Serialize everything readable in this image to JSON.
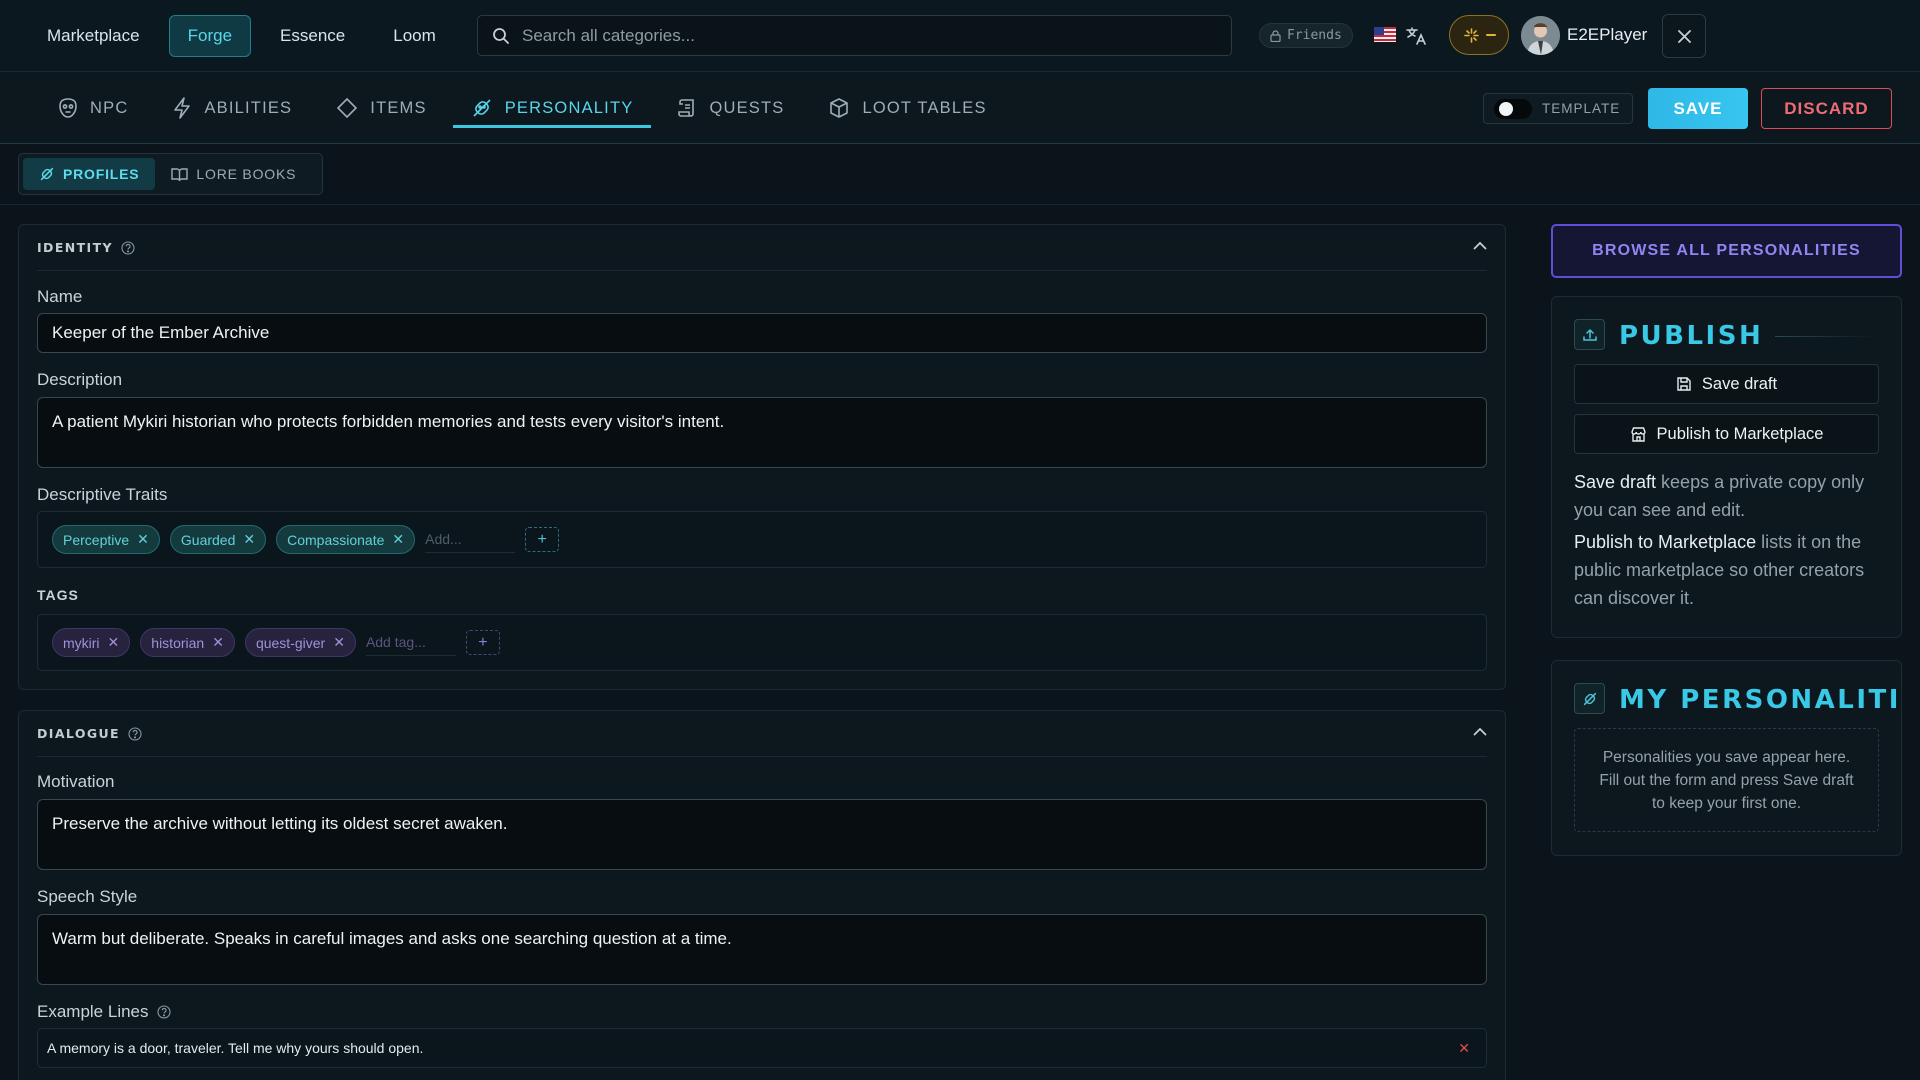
{
  "topnav": {
    "tabs": [
      "Marketplace",
      "Forge",
      "Essence",
      "Loom"
    ],
    "search_placeholder": "Search all categories...",
    "friends_label": "Friends",
    "username": "E2EPlayer"
  },
  "sections": {
    "tabs": [
      "NPC",
      "ABILITIES",
      "ITEMS",
      "PERSONALITY",
      "QUESTS",
      "LOOT TABLES"
    ],
    "template_label": "TEMPLATE",
    "save_label": "SAVE",
    "discard_label": "DISCARD"
  },
  "subtabs": [
    "PROFILES",
    "LORE BOOKS"
  ],
  "identity": {
    "title": "IDENTITY",
    "name_label": "Name",
    "name_value": "Keeper of the Ember Archive",
    "description_label": "Description",
    "description_value": "A patient Mykiri historian who protects forbidden memories and tests every visitor's intent.",
    "traits_label": "Descriptive Traits",
    "traits": [
      "Perceptive",
      "Guarded",
      "Compassionate"
    ],
    "traits_placeholder": "Add...",
    "tags_label": "TAGS",
    "tags": [
      "mykiri",
      "historian",
      "quest-giver"
    ],
    "tags_placeholder": "Add tag..."
  },
  "dialogue": {
    "title": "DIALOGUE",
    "motivation_label": "Motivation",
    "motivation_value": "Preserve the archive without letting its oldest secret awaken.",
    "speech_label": "Speech Style",
    "speech_value": "Warm but deliberate. Speaks in careful images and asks one searching question at a time.",
    "examples_label": "Example Lines",
    "examples": [
      "A memory is a door, traveler. Tell me why yours should open."
    ]
  },
  "sidebar": {
    "browse_label": "BROWSE ALL PERSONALITIES",
    "publish_title": "PUBLISH",
    "save_draft_label": "Save draft",
    "publish_label": "Publish to Marketplace",
    "save_draft_desc_strong": "Save draft",
    "save_draft_desc": " keeps a private copy only you can see and edit.",
    "publish_desc_strong": "Publish to Marketplace",
    "publish_desc": " lists it on the public marketplace so other creators can discover it.",
    "my_title": "MY PERSONALITIES",
    "empty_text": "Personalities you save appear here. Fill out the form and press Save draft to keep your first one."
  },
  "colors": {
    "accent_cyan": "#3ec6df",
    "accent_violet": "#5d4fd8",
    "danger": "#e04b56",
    "background": "#0a141a"
  }
}
